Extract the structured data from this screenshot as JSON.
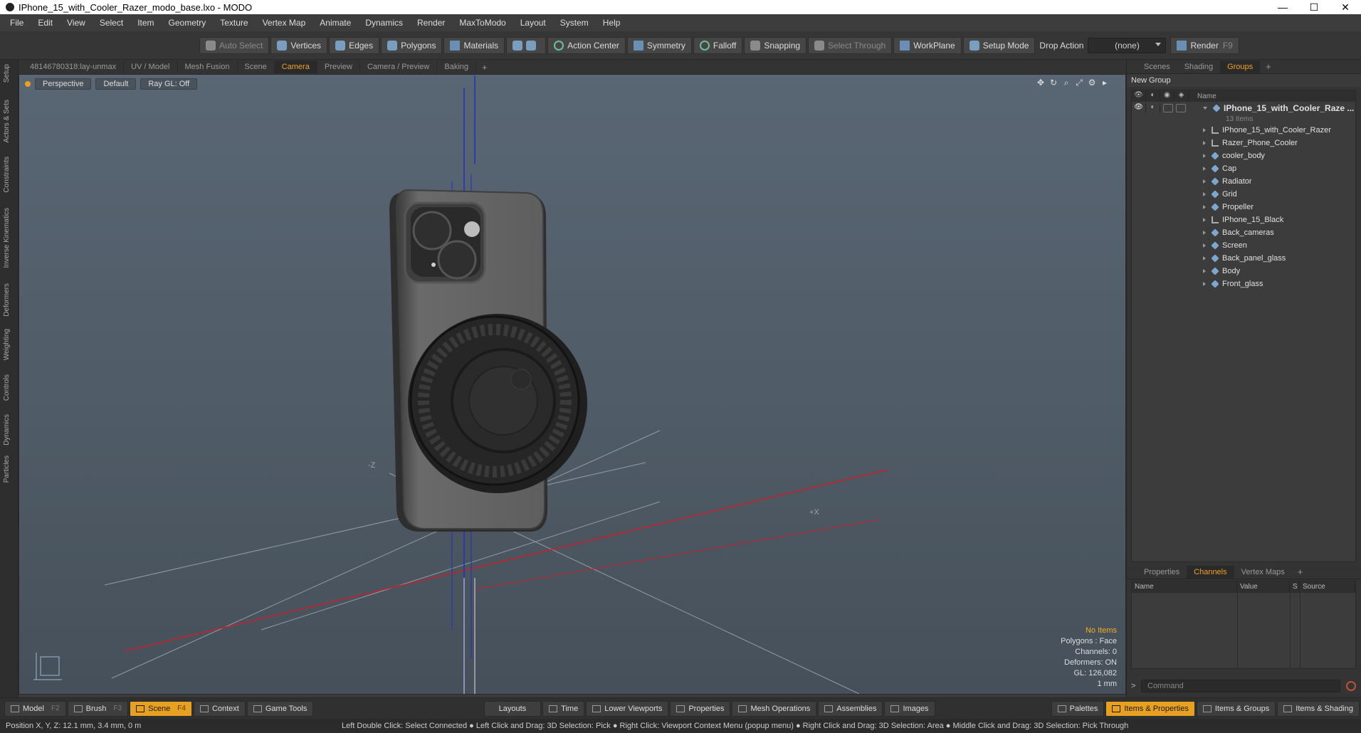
{
  "window": {
    "title": "IPhone_15_with_Cooler_Razer_modo_base.lxo - MODO",
    "controls": [
      "—",
      "☐",
      "✕"
    ]
  },
  "menu": [
    "File",
    "Edit",
    "View",
    "Select",
    "Item",
    "Geometry",
    "Texture",
    "Vertex Map",
    "Animate",
    "Dynamics",
    "Render",
    "MaxToModo",
    "Layout",
    "System",
    "Help"
  ],
  "toolbar": {
    "auto_select": "Auto Select",
    "vertices": "Vertices",
    "edges": "Edges",
    "polygons": "Polygons",
    "materials": "Materials",
    "action_center": "Action Center",
    "symmetry": "Symmetry",
    "falloff": "Falloff",
    "snapping": "Snapping",
    "select_through": "Select Through",
    "workplane": "WorkPlane",
    "setup_mode": "Setup Mode",
    "drop_action": "Drop Action",
    "drop_value": "(none)",
    "render": "Render",
    "render_key": "F9"
  },
  "viewport_tabs": [
    "48146780318:lay-unmax",
    "UV / Model",
    "Mesh Fusion",
    "Scene",
    "Camera",
    "Preview",
    "Camera / Preview",
    "Baking"
  ],
  "viewport_active_tab": "Camera",
  "viewport": {
    "view": "Perspective",
    "shading": "Default",
    "raygl": "Ray GL: Off",
    "axis_label_z": "-Z",
    "axis_label_x": "+X",
    "info": {
      "selection": "No Items",
      "polygons": "Polygons : Face",
      "channels": "Channels: 0",
      "deformers": "Deformers: ON",
      "gl": "GL: 126,082",
      "scale": "1 mm"
    }
  },
  "left_strip": [
    "Setup",
    "Actors & Sets",
    "Constraints",
    "Inverse Kinematics",
    "Deformers",
    "Weighting",
    "Controls",
    "Dynamics",
    "Particles"
  ],
  "right_tabs": [
    "Scenes",
    "Shading",
    "Groups"
  ],
  "right_active_tab": "Groups",
  "groups": {
    "new_group": "New Group",
    "column_name": "Name",
    "root": {
      "name": "IPhone_15_with_Cooler_Raze ...",
      "count": "13 Items"
    },
    "items": [
      {
        "name": "IPhone_15_with_Cooler_Razer",
        "type": "locator"
      },
      {
        "name": "Razer_Phone_Cooler",
        "type": "locator"
      },
      {
        "name": "cooler_body",
        "type": "mesh"
      },
      {
        "name": "Cap",
        "type": "mesh"
      },
      {
        "name": "Radiator",
        "type": "mesh"
      },
      {
        "name": "Grid",
        "type": "mesh"
      },
      {
        "name": "Propeller",
        "type": "mesh"
      },
      {
        "name": "IPhone_15_Black",
        "type": "locator"
      },
      {
        "name": "Back_cameras",
        "type": "mesh"
      },
      {
        "name": "Screen",
        "type": "mesh"
      },
      {
        "name": "Back_panel_glass",
        "type": "mesh"
      },
      {
        "name": "Body",
        "type": "mesh"
      },
      {
        "name": "Front_glass",
        "type": "mesh"
      }
    ]
  },
  "props_tabs": [
    "Properties",
    "Channels",
    "Vertex Maps"
  ],
  "props_active_tab": "Channels",
  "channels_cols": [
    "Name",
    "Value",
    "S",
    "Source"
  ],
  "command_placeholder": "Command",
  "bottom": {
    "left": [
      {
        "label": "Model",
        "key": "F2"
      },
      {
        "label": "Brush",
        "key": "F3"
      },
      {
        "label": "Scene",
        "key": "F4"
      },
      {
        "label": "Context",
        "key": ""
      },
      {
        "label": "Game Tools",
        "key": ""
      }
    ],
    "active": "Scene",
    "center": [
      "Layouts",
      "Time",
      "Lower Viewports",
      "Properties",
      "Mesh Operations",
      "Assemblies",
      "Images"
    ],
    "right": [
      "Palettes",
      "Items & Properties",
      "Items & Groups",
      "Items & Shading"
    ],
    "right_active": "Items & Properties"
  },
  "status": {
    "position": "Position X, Y, Z:  12.1 mm, 3.4 mm, 0 m",
    "hints": "Left Double Click: Select Connected ● Left Click and Drag: 3D Selection: Pick ● Right Click: Viewport Context Menu (popup menu) ● Right Click and Drag: 3D Selection: Area ● Middle Click and Drag: 3D Selection: Pick Through"
  },
  "colors": {
    "accent": "#e8a020",
    "viewport_bg": "#56626e",
    "axis_x": "#c8202a",
    "axis_y": "#2030c0",
    "axis_z": "#20a040"
  }
}
